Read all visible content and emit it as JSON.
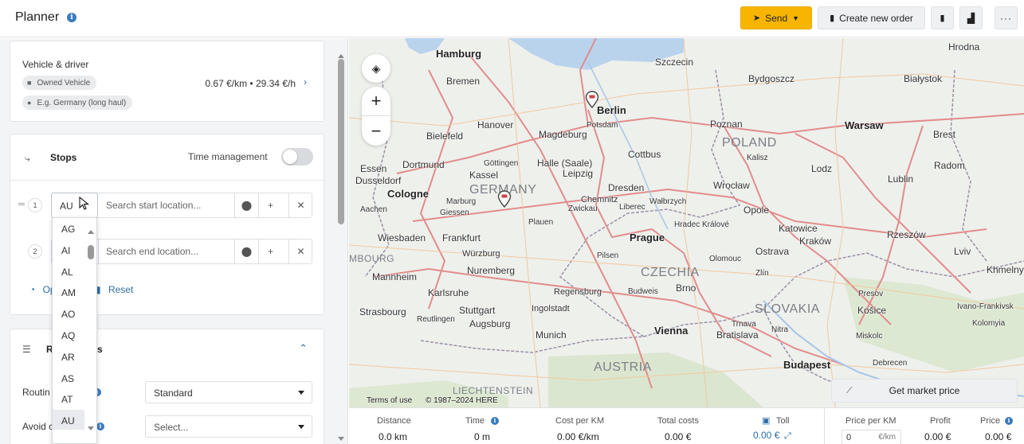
{
  "header": {
    "title": "Planner",
    "send_label": "Send",
    "new_order_label": "Create new order"
  },
  "vehicle": {
    "title": "Vehicle & driver",
    "chip_owned": "Owned Vehicle",
    "chip_profile": "E.g. Germany (long haul)",
    "rate": "0.67 €/km • 29.34 €/h"
  },
  "stops": {
    "title": "Stops",
    "time_management_label": "Time management",
    "time_management_on": false,
    "rows": [
      {
        "number": "1",
        "country": "AU",
        "placeholder": "Search start location..."
      },
      {
        "number": "2",
        "country": "",
        "placeholder": "Search end location..."
      }
    ],
    "optimize_label": "Op",
    "reset_label": "Reset"
  },
  "route": {
    "title_left": "R",
    "title_right": "ns",
    "routing_label": "Routin",
    "routing_value": "Standard",
    "avoid_label": "Avoid c",
    "avoid_placeholder": "Select..."
  },
  "country_dropdown": {
    "options": [
      "AG",
      "AI",
      "AL",
      "AM",
      "AO",
      "AQ",
      "AR",
      "AS",
      "AT",
      "AU"
    ],
    "selected": "AU"
  },
  "map": {
    "cities": [
      "Hamburg",
      "Szczecin",
      "Hrodna",
      "Bremen",
      "Bydgoszcz",
      "Białystok",
      "Berlin",
      "Hanover",
      "Poznan",
      "Warsaw",
      "Brest",
      "Bielefeld",
      "Potsdam",
      "Dortmund",
      "Magdeburg",
      "Cottbus",
      "Lodz",
      "Essen",
      "Halle (Saale)",
      "Kalisz",
      "Dusseldorf",
      "Leipzig",
      "Radom",
      "Cologne",
      "Göttingen",
      "Dresden",
      "Wrocław",
      "Lublin",
      "Kassel",
      "Chemnitz",
      "Opole",
      "Marburg",
      "Zwickau",
      "Liberec",
      "Wałbrzych",
      "Aachen",
      "Giessen",
      "Plauen",
      "Katowice",
      "Wiesbaden",
      "Frankfurt",
      "Prague",
      "Hradec Králové",
      "Kraków",
      "Rzeszów",
      "Lviv",
      "Mannheim",
      "Würzburg",
      "Pilsen",
      "Ostrava",
      "Khmelnyts",
      "Nuremberg",
      "Olomouc",
      "Zlín",
      "Brno",
      "Karlsruhe",
      "Regensburg",
      "Budweis",
      "Presov",
      "Stuttgart",
      "Ingolstadt",
      "Košice",
      "Strasbourg",
      "Augsburg",
      "Reutlingen",
      "Vienna",
      "Trnava",
      "Nitra",
      "Bratislava",
      "Munich",
      "Miskolc",
      "Ivano-Frankivsk",
      "Kolomyia",
      "Budapest",
      "Debrecen"
    ],
    "countries": [
      "GERMANY",
      "POLAND",
      "CZECHIA",
      "SLOVAKIA",
      "AUSTRIA",
      "LIECHTENSTEIN",
      "MBOURG"
    ],
    "terms_label": "Terms of use",
    "copyright": "© 1987–2024 HERE"
  },
  "market": {
    "label": "Get market price"
  },
  "stats": {
    "distance_label": "Distance",
    "distance_value": "0.0 km",
    "time_label": "Time",
    "time_value": "0 m",
    "cost_per_km_label": "Cost per KM",
    "cost_per_km_value": "0.00 €/km",
    "total_costs_label": "Total costs",
    "total_costs_value": "0.00 €",
    "toll_label": "Toll",
    "toll_value": "0.00 €",
    "price_per_km_label": "Price per KM",
    "price_per_km_value": "0",
    "price_per_km_unit": "€/km",
    "profit_label": "Profit",
    "profit_value": "0.00 €",
    "price_label": "Price",
    "price_value": "0.00 €"
  },
  "colors": {
    "accent": "#f7b500",
    "link": "#2d6da8",
    "info": "#3b7bbf"
  }
}
